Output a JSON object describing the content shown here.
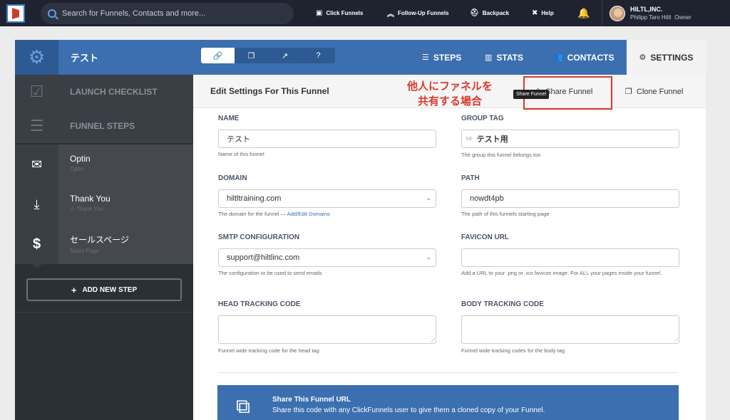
{
  "topbar": {
    "search_placeholder": "Search for Funnels, Contacts and more...",
    "nav": [
      {
        "label": "Click Funnels",
        "icon": "funnel-icon"
      },
      {
        "label": "Follow-Up Funnels",
        "icon": "chevrons-up-icon"
      },
      {
        "label": "Backpack",
        "icon": "backpack-icon"
      },
      {
        "label": "Help",
        "icon": "help-icon"
      }
    ],
    "company": "HILTL,INC.",
    "user_name": "Philipp Taro Hiltl",
    "user_role": "Owner"
  },
  "funnel_header": {
    "title": "テスト",
    "tabs": [
      {
        "label": "STEPS",
        "icon": "list-icon"
      },
      {
        "label": "STATS",
        "icon": "bar-chart-icon"
      },
      {
        "label": "CONTACTS",
        "icon": "users-icon"
      },
      {
        "label": "SETTINGS",
        "icon": "gear-icon"
      }
    ]
  },
  "sidebar": {
    "launch_checklist": "LAUNCH CHECKLIST",
    "funnel_steps": "FUNNEL STEPS",
    "steps": [
      {
        "name": "Optin",
        "sub": "Optin",
        "icon": "envelope-icon"
      },
      {
        "name": "Thank You",
        "sub": "Thank You",
        "icon": "download-icon"
      },
      {
        "name": "セールスページ",
        "sub": "Sales Page",
        "icon": "dollar-icon"
      }
    ],
    "add_step": "ADD NEW STEP"
  },
  "main": {
    "title": "Edit Settings For This Funnel",
    "share_funnel": "Share Funnel",
    "clone_funnel": "Clone Funnel",
    "tooltip": "Share Funnel",
    "annotation_line1": "他人にファネルを",
    "annotation_line2": "共有する場合",
    "fields": {
      "name": {
        "label": "NAME",
        "value": "テスト",
        "hint": "Name of this funnel"
      },
      "group_tag": {
        "label": "GROUP TAG",
        "prefix": "h3",
        "value": "テスト用",
        "hint": "The group this funnel belongs too"
      },
      "domain": {
        "label": "DOMAIN",
        "value": "hiltltraining.com",
        "hint": "The domain for the funnel —",
        "hint_link": "Add/Edit Domains"
      },
      "path": {
        "label": "PATH",
        "value": "nowdt4pb",
        "hint": "The path of this funnels starting page"
      },
      "smtp": {
        "label": "SMTP CONFIGURATION",
        "value": "support@hiltlinc.com",
        "hint": "The configuration to be used to send emails"
      },
      "favicon": {
        "label": "FAVICON URL",
        "value": "",
        "hint": "Add a URL to your .png or .ico favicon image. For ALL your pages inside your funnel."
      },
      "head_tracking": {
        "label": "HEAD TRACKING CODE",
        "hint": "Funnel wide tracking code for the head tag"
      },
      "body_tracking": {
        "label": "BODY TRACKING CODE",
        "hint": "Funnel wide tracking codes for the body tag"
      }
    },
    "share_box": {
      "title": "Share This Funnel URL",
      "text": "Share this code with any ClickFunnels user to give them a cloned copy of your Funnel."
    }
  }
}
